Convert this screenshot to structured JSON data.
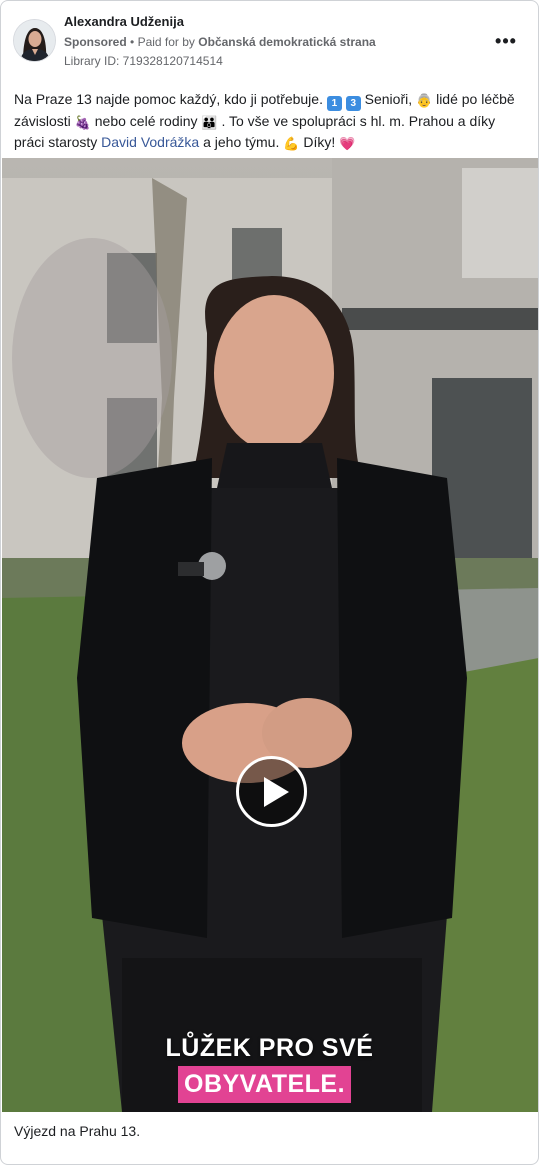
{
  "advertiser": {
    "name": "Alexandra Udženija",
    "sponsored_label": "Sponsored",
    "separator": "•",
    "paid_for_prefix": "Paid for by",
    "paid_for_by": "Občanská demokratická strana",
    "library_id": "Library ID: 719328120714514"
  },
  "post": {
    "segment_1": "Na Praze 13 najde pomoc každý, kdo ji potřebuje.",
    "key_1": "1",
    "key_2": "3",
    "segment_2": "Senioři,",
    "segment_3": "lidé po léčbě závislosti",
    "segment_4": "nebo celé rodiny",
    "segment_5": ". To vše ve spolupráci s hl. m. Prahou a díky práci starosty",
    "mention": "David Vodrážka",
    "segment_6": "a jeho týmu.",
    "segment_7": "Díky!"
  },
  "emojis": {
    "older_person": "👵",
    "pill": "🍇",
    "family": "👪",
    "muscle": "💪",
    "heart": "💗"
  },
  "video": {
    "caption_line_1": "LŮŽEK PRO SVÉ",
    "caption_line_2": "OBYVATELE.",
    "caption_highlight_color": "#e24393"
  },
  "footer": {
    "title": "Výjezd na Prahu 13."
  },
  "icons": {
    "more": "more-options-icon",
    "play": "play-icon"
  }
}
